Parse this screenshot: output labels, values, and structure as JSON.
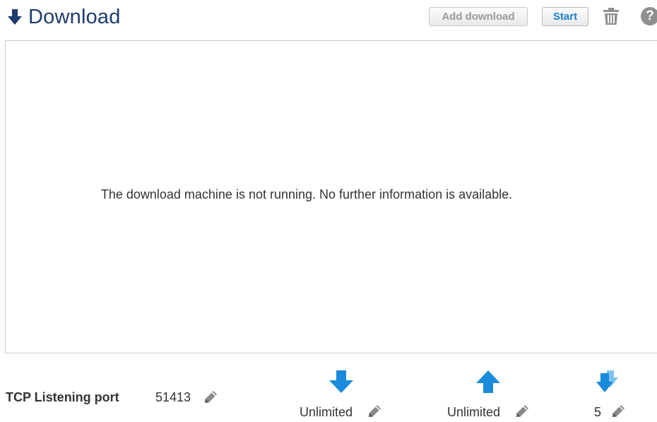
{
  "header": {
    "title": "Download",
    "title_icon": "download-arrow-icon",
    "add_download_label": "Add download",
    "start_label": "Start",
    "trash_icon": "trash-icon",
    "help_icon": "help-icon",
    "help_glyph": "?"
  },
  "panel": {
    "message": "The download machine is not running. No further information is available."
  },
  "footer": {
    "port_label": "TCP Listening port",
    "port_value": "51413",
    "download_limit": "Unlimited",
    "upload_limit": "Unlimited",
    "queue_count": "5"
  },
  "colors": {
    "title": "#1f3a6d",
    "accent_blue": "#1a8bdb",
    "start_text": "#1f7fcf",
    "disabled_text": "#9a9a9a"
  }
}
